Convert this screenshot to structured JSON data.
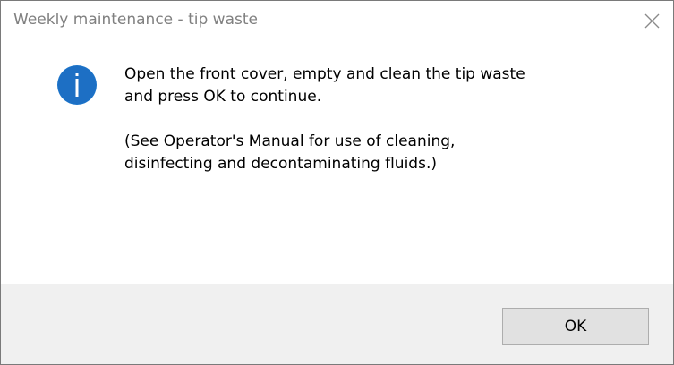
{
  "window": {
    "title": "Weekly maintenance - tip waste",
    "close_icon": "close-icon"
  },
  "dialog": {
    "icon": "info-icon",
    "icon_color": "#1a73c9",
    "message_line1": "Open the front cover, empty and clean the tip waste",
    "message_line2": "and press OK to continue.",
    "note_line1": "(See Operator's Manual for use of cleaning,",
    "note_line2": "disinfecting and decontaminating fluids.)"
  },
  "buttons": {
    "ok_label": "OK"
  }
}
